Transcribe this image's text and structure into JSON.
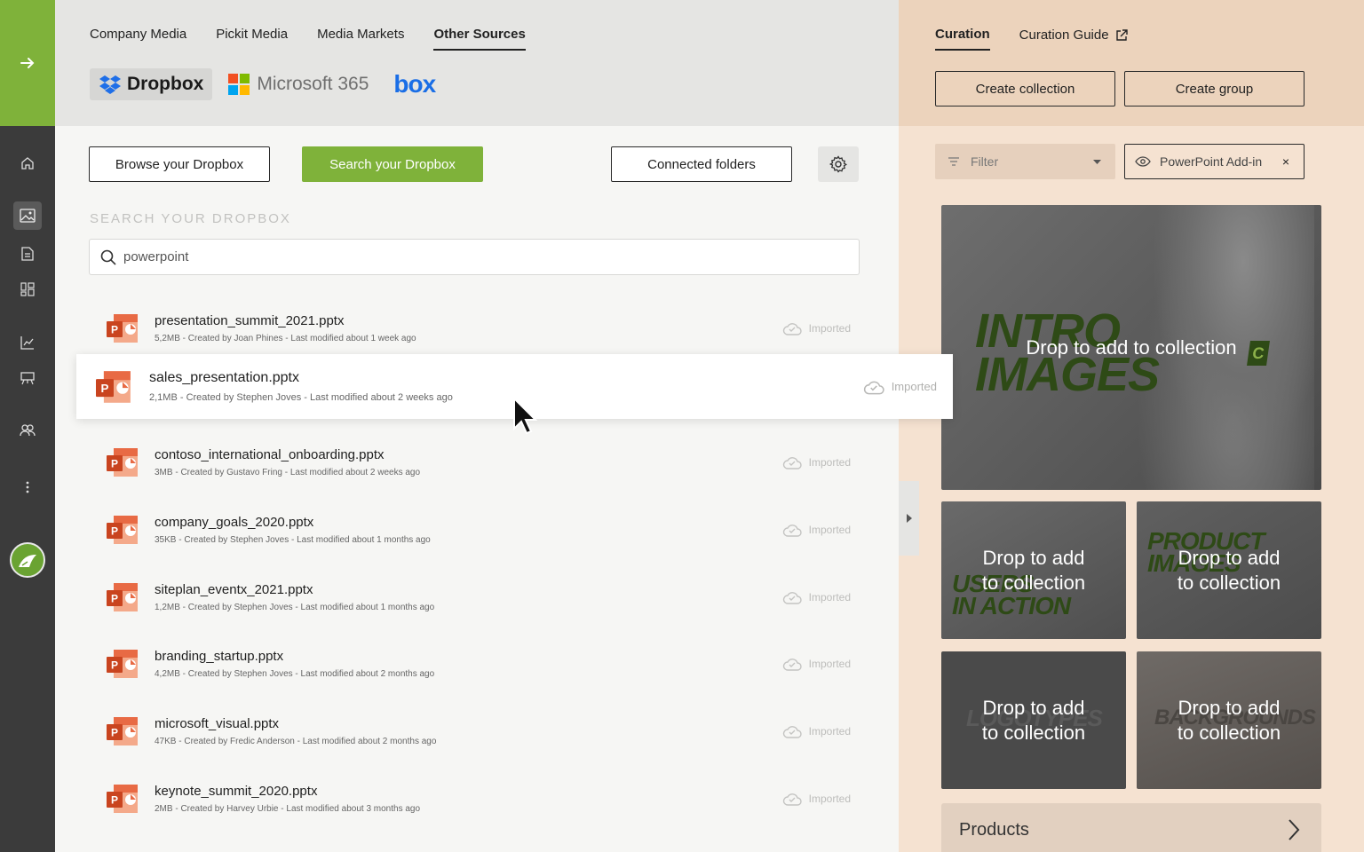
{
  "source_tabs": [
    {
      "label": "Company Media",
      "active": false
    },
    {
      "label": "Pickit Media",
      "active": false
    },
    {
      "label": "Media Markets",
      "active": false
    },
    {
      "label": "Other Sources",
      "active": true
    }
  ],
  "providers": {
    "dropbox": "Dropbox",
    "microsoft": "Microsoft 365",
    "box": "box"
  },
  "toolbar": {
    "browse_label": "Browse your Dropbox",
    "search_label": "Search your Dropbox",
    "connected_label": "Connected folders"
  },
  "search": {
    "section_label": "SEARCH YOUR DROPBOX",
    "value": "powerpoint"
  },
  "files": [
    {
      "name": "presentation_summit_2021.pptx",
      "meta": "5,2MB - Created by Joan Phines - Last modified about 1 week ago",
      "status": "Imported"
    },
    {
      "name": "sales_presentation.pptx",
      "meta": "2,1MB - Created by Stephen Joves - Last modified about 2 weeks ago",
      "status": "Imported"
    },
    {
      "name": "contoso_international_onboarding.pptx",
      "meta": "3MB - Created by Gustavo Fring - Last modified about 2 weeks ago",
      "status": "Imported"
    },
    {
      "name": "company_goals_2020.pptx",
      "meta": "35KB - Created by Stephen Joves - Last modified about 1 months ago",
      "status": "Imported"
    },
    {
      "name": "siteplan_eventx_2021.pptx",
      "meta": "1,2MB - Created by Stephen Joves - Last modified about 1 months ago",
      "status": "Imported"
    },
    {
      "name": "branding_startup.pptx",
      "meta": "4,2MB - Created by Stephen Joves - Last modified about 2 months ago",
      "status": "Imported"
    },
    {
      "name": "microsoft_visual.pptx",
      "meta": "47KB - Created by Fredic Anderson - Last modified about 2 months ago",
      "status": "Imported"
    },
    {
      "name": "keynote_summit_2020.pptx",
      "meta": "2MB - Created by Harvey Urbie - Last modified about 3 months ago",
      "status": "Imported"
    }
  ],
  "curation": {
    "tabs": [
      "Curation",
      "Curation Guide"
    ],
    "create_collection": "Create collection",
    "create_group": "Create group",
    "filter_label": "Filter",
    "chip_label": "PowerPoint Add-in",
    "chip_close": "×",
    "big_tile_bg": "INTRO IMAGES",
    "big_tile_bg_line1": "INTRO",
    "big_tile_bg_line2": "IMAGES",
    "big_tile_badge": "C",
    "tiles": [
      {
        "bg_line1": "USERS",
        "bg_line2": "IN ACTION",
        "line1": "Drop to add",
        "line2": "to collection"
      },
      {
        "bg_line1": "PRODUCT",
        "bg_line2": "IMAGES",
        "line1": "Drop to add",
        "line2": "to collection"
      },
      {
        "bg_line1": "LOGOTYPES",
        "bg_line2": "",
        "line1": "Drop to add",
        "line2": "to collection"
      },
      {
        "bg_line1": "BACKGROUNDS",
        "bg_line2": "",
        "line1": "Drop to add",
        "line2": "to collection"
      }
    ],
    "big_tile_text": "Drop to add to collection",
    "products_label": "Products"
  }
}
